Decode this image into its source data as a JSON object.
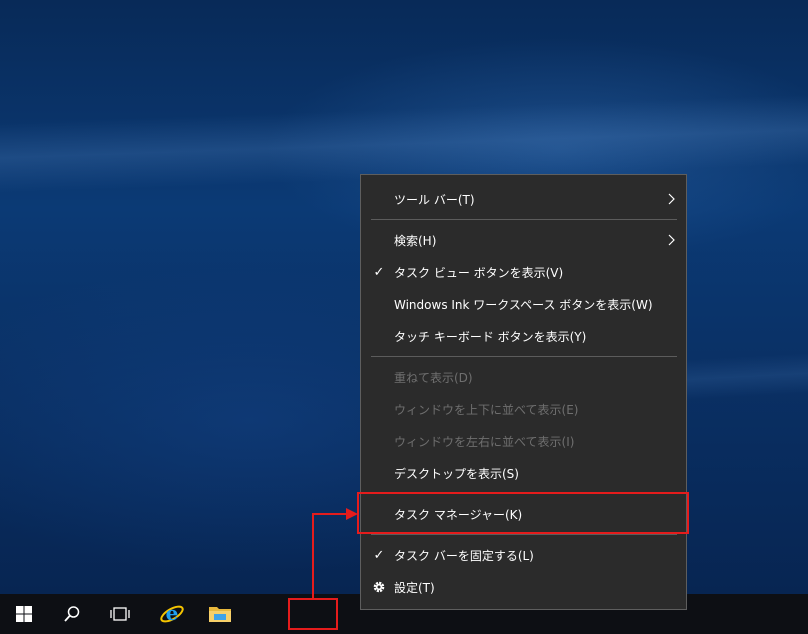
{
  "context_menu": {
    "items": [
      {
        "label": "ツール バー(T)",
        "submenu": true
      },
      {
        "label": "検索(H)",
        "submenu": true
      },
      {
        "label": "タスク ビュー ボタンを表示(V)",
        "checked": true
      },
      {
        "label": "Windows Ink ワークスペース ボタンを表示(W)"
      },
      {
        "label": "タッチ キーボード ボタンを表示(Y)"
      },
      {
        "label": "重ねて表示(D)",
        "disabled": true
      },
      {
        "label": "ウィンドウを上下に並べて表示(E)",
        "disabled": true
      },
      {
        "label": "ウィンドウを左右に並べて表示(I)",
        "disabled": true
      },
      {
        "label": "デスクトップを表示(S)"
      },
      {
        "label": "タスク マネージャー(K)",
        "highlighted": true
      },
      {
        "label": "タスク バーを固定する(L)",
        "checked": true
      },
      {
        "label": "設定(T)",
        "icon": "gear-icon"
      }
    ],
    "check_mark": "✓"
  },
  "taskbar": {
    "buttons": [
      "windows-start-icon",
      "search-icon",
      "task-view-icon",
      "internet-explorer-icon",
      "file-explorer-icon"
    ]
  },
  "colors": {
    "menu_bg": "#2b2b2b",
    "annotation": "#e51c1c",
    "taskbar_bg": "#0d0f14"
  }
}
